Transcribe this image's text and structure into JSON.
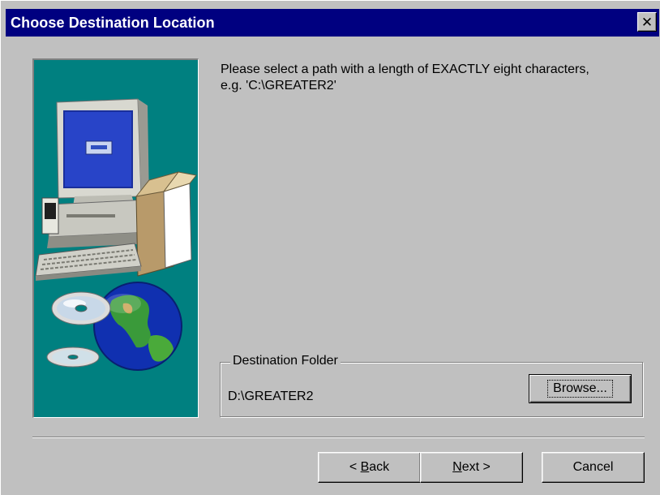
{
  "dialog": {
    "title": "Choose Destination Location",
    "close_label": "✕"
  },
  "instructions": {
    "line1": "Please select a path with a length of EXACTLY eight characters,",
    "line2": "e.g. 'C:\\GREATER2'"
  },
  "destination": {
    "legend": "Destination Folder",
    "path": "D:\\GREATER2",
    "browse_label": "Browse..."
  },
  "buttons": {
    "back_prefix": "< ",
    "back_key": "B",
    "back_rest": "ack",
    "next_key": "N",
    "next_rest": "ext >",
    "cancel": "Cancel"
  },
  "colors": {
    "titlebar": "#000080",
    "face": "#c0c0c0",
    "illustration_bg": "#008080"
  },
  "illustration": {
    "icons": [
      "computer-monitor-icon",
      "software-box-icon",
      "keyboard-icon",
      "cd-disc-icon",
      "globe-icon"
    ]
  }
}
